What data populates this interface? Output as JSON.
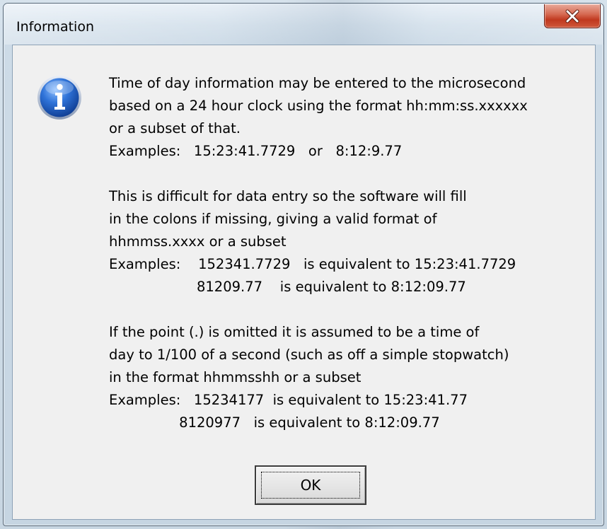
{
  "window": {
    "title": "Information"
  },
  "icons": {
    "close": "close-x-icon",
    "message": "information-icon"
  },
  "colors": {
    "close_button": "#c7432a",
    "info_icon": "#1f5fc7",
    "dialog_background": "#f0f0f0"
  },
  "message": {
    "lines": [
      "Time of day information may be entered to the microsecond",
      "based on a 24 hour clock using the format hh:mm:ss.xxxxxx",
      "or a subset of that.",
      "Examples:   15:23:41.7729   or   8:12:9.77",
      "",
      "This is difficult for data entry so the software will fill",
      "in the colons if missing, giving a valid format of",
      "hhmmss.xxxx or a subset",
      "Examples:    152341.7729   is equivalent to 15:23:41.7729",
      "                    81209.77    is equivalent to 8:12:09.77",
      "",
      "If the point (.) is omitted it is assumed to be a time of",
      "day to 1/100 of a second (such as off a simple stopwatch)",
      "in the format hhmmsshh or a subset",
      "Examples:   15234177  is equivalent to 15:23:41.77",
      "                8120977   is equivalent to 8:12:09.77"
    ]
  },
  "buttons": {
    "ok_label": "OK"
  }
}
